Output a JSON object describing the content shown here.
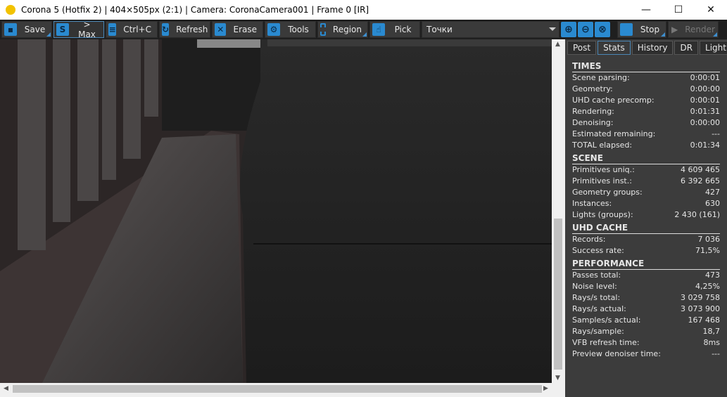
{
  "title": "Corona 5 (Hotfix 2) | 404×505px (2:1) | Camera: CoronaCamera001 | Frame 0 [IR]",
  "window_controls": {
    "minimize": "—",
    "maximize": "☐",
    "close": "✕"
  },
  "toolbar": {
    "save": "Save",
    "max": "> Max",
    "copy": "Ctrl+C",
    "refresh": "Refresh",
    "erase": "Erase",
    "tools": "Tools",
    "region": "Region",
    "pick": "Pick",
    "channel": "Точки",
    "stop": "Stop",
    "render": "Render"
  },
  "tabs": [
    "Post",
    "Stats",
    "History",
    "DR",
    "LightMix"
  ],
  "sections": [
    {
      "title": "TIMES",
      "rows": [
        [
          "Scene parsing:",
          "0:00:01"
        ],
        [
          "Geometry:",
          "0:00:00"
        ],
        [
          "UHD cache precomp:",
          "0:00:01"
        ],
        [
          "Rendering:",
          "0:01:31"
        ],
        [
          "Denoising:",
          "0:00:00"
        ],
        [
          "Estimated remaining:",
          "---"
        ],
        [
          "TOTAL elapsed:",
          "0:01:34"
        ]
      ]
    },
    {
      "title": "SCENE",
      "rows": [
        [
          "Primitives uniq.:",
          "4 609 465"
        ],
        [
          "Primitives inst.:",
          "6 392 665"
        ],
        [
          "Geometry groups:",
          "427"
        ],
        [
          "Instances:",
          "630"
        ],
        [
          "Lights (groups):",
          "2 430 (161)"
        ]
      ]
    },
    {
      "title": "UHD CACHE",
      "rows": [
        [
          "Records:",
          "7 036"
        ],
        [
          "Success rate:",
          "71,5%"
        ]
      ]
    },
    {
      "title": "PERFORMANCE",
      "rows": [
        [
          "Passes total:",
          "473"
        ],
        [
          "Noise level:",
          "4,25%"
        ],
        [
          "Rays/s total:",
          "3 029 758"
        ],
        [
          "Rays/s actual:",
          "3 073 900"
        ],
        [
          "Samples/s actual:",
          "167 468"
        ],
        [
          "Rays/sample:",
          "18,7"
        ],
        [
          "VFB refresh time:",
          "8ms"
        ],
        [
          "Preview denoiser time:",
          "---"
        ]
      ]
    }
  ]
}
